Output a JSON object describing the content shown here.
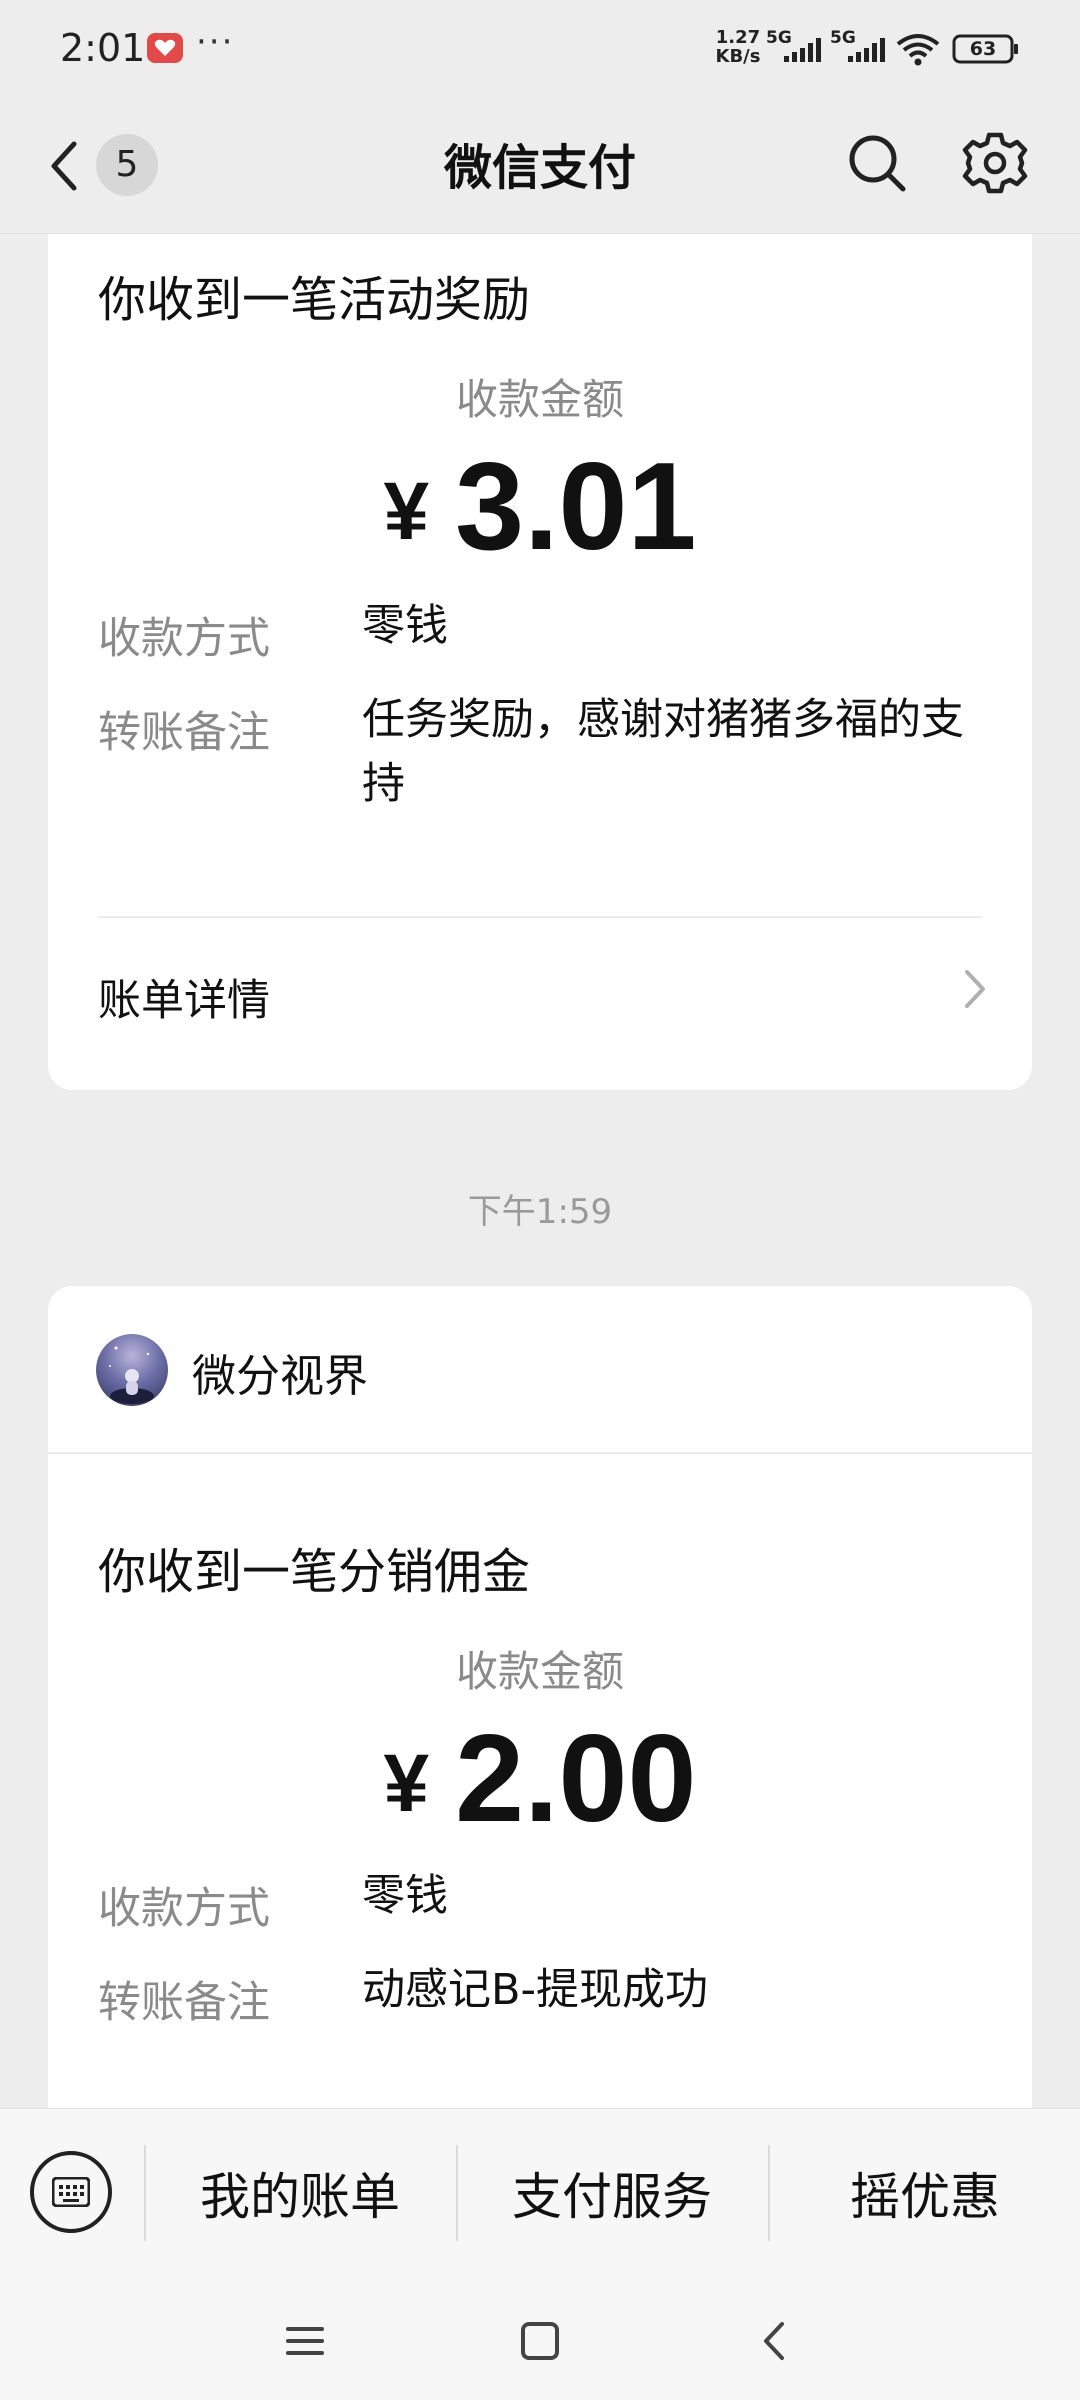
{
  "status_bar": {
    "time": "2:01",
    "more": "···",
    "net_speed_value": "1.27",
    "net_speed_unit": "KB/s",
    "signal1_label": "5G",
    "signal2_label": "5G",
    "battery": "63"
  },
  "header": {
    "title": "微信支付",
    "unread_count": "5"
  },
  "messages": [
    {
      "title": "你收到一笔活动奖励",
      "amount_label": "收款金额",
      "currency": "¥",
      "amount": "3.01",
      "method_label": "收款方式",
      "method_value": "零钱",
      "note_label": "转账备注",
      "note_value": "任务奖励，感谢对猪猪多福的支持",
      "detail_label": "账单详情"
    },
    {
      "timestamp": "下午1:59",
      "merchant": "微分视界",
      "title": "你收到一笔分销佣金",
      "amount_label": "收款金额",
      "currency": "¥",
      "amount": "2.00",
      "method_label": "收款方式",
      "method_value": "零钱",
      "note_label": "转账备注",
      "note_value": "动感记B-提现成功"
    }
  ],
  "bottom_menu": {
    "items": [
      "我的账单",
      "支付服务",
      "摇优惠"
    ]
  },
  "icons": {
    "back": "chevron-left-icon",
    "search": "search-icon",
    "settings": "gear-icon",
    "keyboard": "keyboard-icon",
    "nav_menu": "menu-icon",
    "nav_home": "home-icon",
    "nav_back": "back-icon"
  },
  "colors": {
    "page_background": "#ededed",
    "card_background": "#ffffff",
    "secondary_text": "#8a8a8a"
  }
}
